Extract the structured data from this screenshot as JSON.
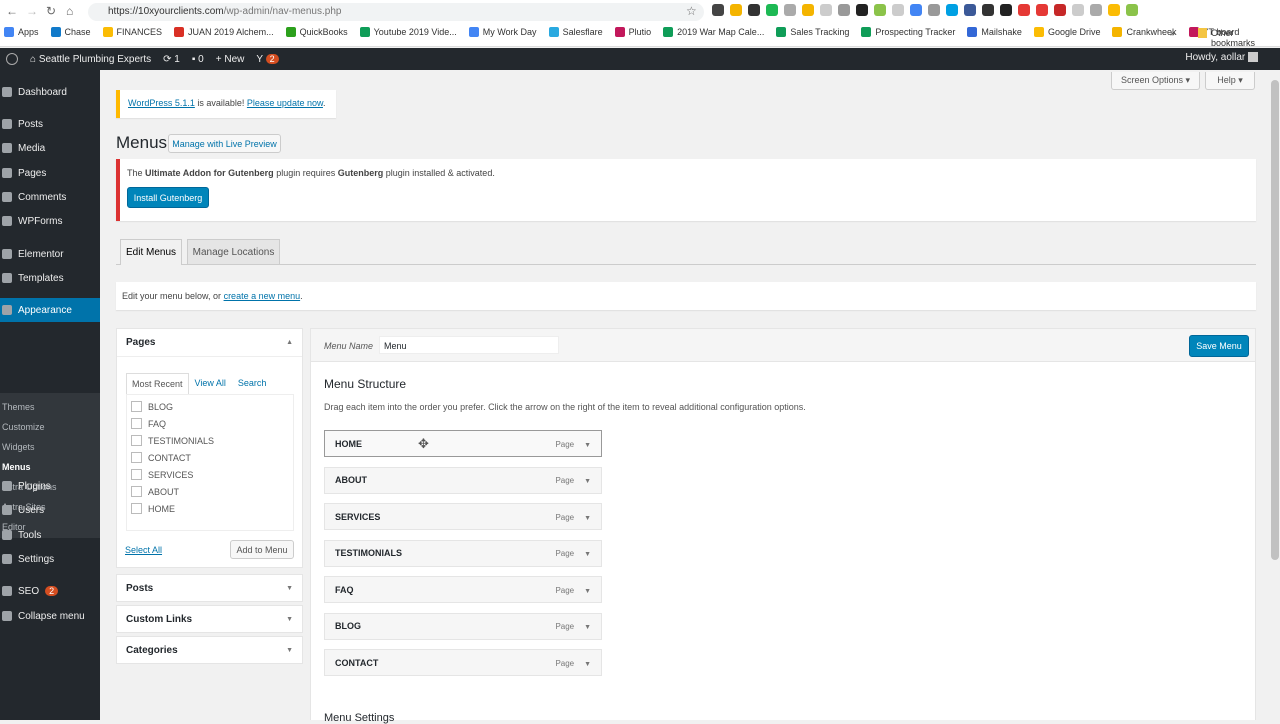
{
  "browser": {
    "url_host": "https://10xyourclients.com",
    "url_path": "/wp-admin/nav-menus.php",
    "bookmarks": [
      {
        "label": "Apps",
        "color": "#4285f4"
      },
      {
        "label": "Chase",
        "color": "#117aca"
      },
      {
        "label": "FINANCES",
        "color": "#fbbc04"
      },
      {
        "label": "JUAN 2019 Alchem...",
        "color": "#d93025"
      },
      {
        "label": "QuickBooks",
        "color": "#2ca01c"
      },
      {
        "label": "Youtube 2019 Vide...",
        "color": "#0f9d58"
      },
      {
        "label": "My Work Day",
        "color": "#4285f4"
      },
      {
        "label": "Salesflare",
        "color": "#29a9e0"
      },
      {
        "label": "Plutio",
        "color": "#c2185b"
      },
      {
        "label": "2019 War Map Cale...",
        "color": "#0f9d58"
      },
      {
        "label": "Sales Tracking",
        "color": "#0f9d58"
      },
      {
        "label": "Prospecting Tracker",
        "color": "#0f9d58"
      },
      {
        "label": "Mailshake",
        "color": "#3367d6"
      },
      {
        "label": "Google Drive",
        "color": "#fbbc04"
      },
      {
        "label": "Crankwheek",
        "color": "#f4b400"
      },
      {
        "label": "YT board",
        "color": "#c2185b"
      }
    ],
    "more": "»",
    "other_bookmarks": "Other bookmarks",
    "extension_colors": [
      "#444",
      "#f4b400",
      "#333",
      "#1db954",
      "#aaa",
      "#f4b400",
      "#ccc",
      "#999",
      "#222",
      "#8bc34a",
      "#ccc",
      "#4285f4",
      "#999",
      "#00a0e3",
      "#3b5998",
      "#333",
      "#222",
      "#e53935",
      "#e53935",
      "#c62828",
      "#ccc",
      "#aaa",
      "#fbbc04",
      "#8bc34a"
    ]
  },
  "adminbar": {
    "site": "Seattle Plumbing Experts",
    "updates": "1",
    "comments": "0",
    "new": "New",
    "yoast_count": "2",
    "howdy": "Howdy, aollar"
  },
  "sidebar": {
    "items": [
      "Dashboard",
      "Posts",
      "Media",
      "Pages",
      "Comments",
      "WPForms",
      "Elementor",
      "Templates",
      "Appearance",
      "Plugins",
      "Users",
      "Tools",
      "Settings",
      "SEO",
      "Collapse menu"
    ],
    "seo_badge": "2",
    "submenu": [
      "Themes",
      "Customize",
      "Widgets",
      "Menus",
      "Astra Options",
      "Astra Sites",
      "Editor"
    ]
  },
  "top": {
    "screen_options": "Screen Options ▾",
    "help": "Help ▾"
  },
  "notice": {
    "wp_version": "WordPress 5.1.1",
    "mid": " is available! ",
    "update": "Please update now",
    "end": "."
  },
  "page": {
    "title": "Menus",
    "live_preview": "Manage with Live Preview"
  },
  "error": {
    "p1": "The ",
    "b1": "Ultimate Addon for Gutenberg",
    "p2": " plugin requires ",
    "b2": "Gutenberg",
    "p3": " plugin installed & activated.",
    "button": "Install Gutenberg"
  },
  "tabs": [
    "Edit Menus",
    "Manage Locations"
  ],
  "manage": {
    "text": "Edit your menu below, or ",
    "link": "create a new menu",
    "end": "."
  },
  "pages_box": {
    "title": "Pages",
    "tabs": [
      "Most Recent",
      "View All",
      "Search"
    ],
    "items": [
      "BLOG",
      "FAQ",
      "TESTIMONIALS",
      "CONTACT",
      "SERVICES",
      "ABOUT",
      "HOME"
    ],
    "select_all": "Select All",
    "add": "Add to Menu"
  },
  "other_boxes": [
    "Posts",
    "Custom Links",
    "Categories"
  ],
  "menu": {
    "name_label": "Menu Name",
    "name_value": "Menu",
    "save": "Save Menu",
    "structure_title": "Menu Structure",
    "instructions": "Drag each item into the order you prefer. Click the arrow on the right of the item to reveal additional configuration options.",
    "items": [
      {
        "title": "HOME",
        "type": "Page"
      },
      {
        "title": "ABOUT",
        "type": "Page"
      },
      {
        "title": "SERVICES",
        "type": "Page"
      },
      {
        "title": "TESTIMONIALS",
        "type": "Page"
      },
      {
        "title": "FAQ",
        "type": "Page"
      },
      {
        "title": "BLOG",
        "type": "Page"
      },
      {
        "title": "CONTACT",
        "type": "Page"
      }
    ],
    "settings_title": "Menu Settings"
  }
}
